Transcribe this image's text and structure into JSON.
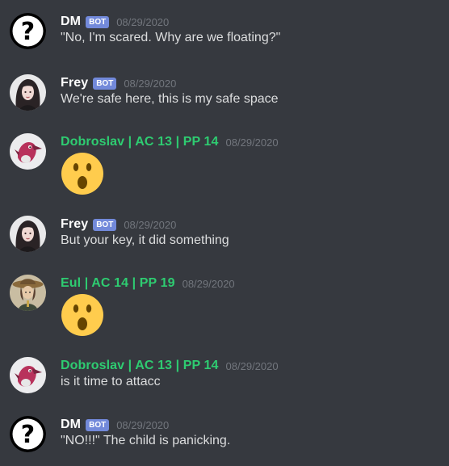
{
  "colors": {
    "background": "#36393f",
    "username_default": "#ffffff",
    "username_role": "#2ecc71",
    "bot_tag": "#7289da",
    "timestamp": "#72767d",
    "message_text": "#dcddde"
  },
  "messages": [
    {
      "avatar": "question-mark-avatar",
      "username": "DM",
      "bot_tag": "BOT",
      "timestamp": "08/29/2020",
      "text": "\"No, I'm scared. Why are we floating?\""
    },
    {
      "avatar": "dark-haired-woman-avatar",
      "username": "Frey",
      "bot_tag": "BOT",
      "timestamp": "08/29/2020",
      "text": "We're safe here, this is my safe space"
    },
    {
      "avatar": "pink-bird-avatar",
      "username": "Dobroslav | AC 13 | PP 14",
      "timestamp": "08/29/2020",
      "emoji": "open-mouth-emoji"
    },
    {
      "avatar": "dark-haired-woman-avatar",
      "username": "Frey",
      "bot_tag": "BOT",
      "timestamp": "08/29/2020",
      "text": "But your key, it did something"
    },
    {
      "avatar": "hat-character-avatar",
      "username": "Eul | AC 14 | PP 19",
      "timestamp": "08/29/2020",
      "emoji": "open-mouth-emoji"
    },
    {
      "avatar": "pink-bird-avatar",
      "username": "Dobroslav | AC 13 | PP 14",
      "timestamp": "08/29/2020",
      "text": "is it time to attacc"
    },
    {
      "avatar": "question-mark-avatar",
      "username": "DM",
      "bot_tag": "BOT",
      "timestamp": "08/29/2020",
      "text": "\"NO!!!\" The child is panicking."
    }
  ]
}
